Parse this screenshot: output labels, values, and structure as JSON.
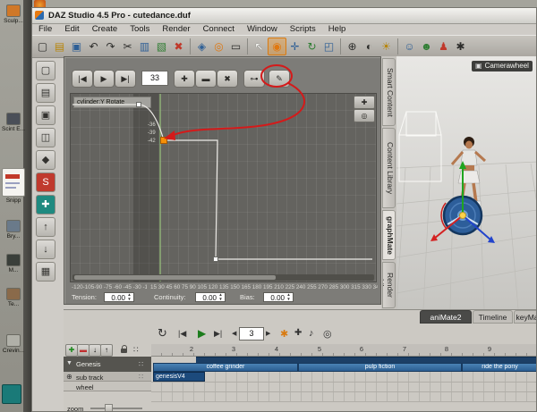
{
  "colors": {
    "accent_orange": "#f59008",
    "clip_blue": "#2b5e92",
    "annotation_red": "#d41a1a"
  },
  "desktop": {
    "items": [
      {
        "label": "Sculp..."
      },
      {
        "label": "Scint E..."
      },
      {
        "label": "Snipp"
      },
      {
        "label": "Bry..."
      },
      {
        "label": "M..."
      },
      {
        "label": "Te..."
      },
      {
        "label": "Crevin..."
      }
    ]
  },
  "titlebar": {
    "title": "DAZ Studio 4.5 Pro - cutedance.duf"
  },
  "menubar": {
    "items": [
      {
        "label": "File"
      },
      {
        "label": "Edit"
      },
      {
        "label": "Create"
      },
      {
        "label": "Tools"
      },
      {
        "label": "Render"
      },
      {
        "label": "Connect"
      },
      {
        "label": "Window"
      },
      {
        "label": "Scripts"
      },
      {
        "label": "Help"
      }
    ]
  },
  "toolbar": {
    "icons": [
      {
        "name": "new-icon",
        "glyph": "▢"
      },
      {
        "name": "open-icon",
        "glyph": "▤"
      },
      {
        "name": "save-icon",
        "glyph": "▣"
      },
      {
        "name": "undo-icon",
        "glyph": "↶"
      },
      {
        "name": "redo-icon",
        "glyph": "↷"
      },
      {
        "name": "cut-icon",
        "glyph": "✂"
      },
      {
        "name": "copy-icon",
        "glyph": "▥"
      },
      {
        "name": "paste-icon",
        "glyph": "▧"
      },
      {
        "name": "delete-icon",
        "glyph": "✖"
      },
      {
        "name": "scene-icon",
        "glyph": "◈"
      },
      {
        "name": "aim-icon",
        "glyph": "◎"
      },
      {
        "name": "frame-icon",
        "glyph": "▭"
      },
      {
        "name": "node-select-tool-icon",
        "glyph": "↖"
      },
      {
        "name": "active-pose-tool-icon",
        "glyph": "◉"
      },
      {
        "name": "translate-tool-icon",
        "glyph": "✛"
      },
      {
        "name": "rotate-tool-icon",
        "glyph": "↻"
      },
      {
        "name": "scale-tool-icon",
        "glyph": "◰"
      },
      {
        "name": "pan-tool-icon",
        "glyph": "⊕"
      },
      {
        "name": "camera-icon",
        "glyph": "◐"
      },
      {
        "name": "light-icon",
        "glyph": "☀"
      },
      {
        "name": "actor-icon",
        "glyph": "☺"
      },
      {
        "name": "actor2-icon",
        "glyph": "☻"
      },
      {
        "name": "pose-icon",
        "glyph": "♟"
      },
      {
        "name": "settings-icon",
        "glyph": "✱"
      }
    ]
  },
  "left_toolbar": {
    "icons": [
      {
        "name": "new-file-icon",
        "glyph": "▢"
      },
      {
        "name": "open-folder-icon",
        "glyph": "▤"
      },
      {
        "name": "save-file-icon",
        "glyph": "▣"
      },
      {
        "name": "merge-icon",
        "glyph": "◫"
      },
      {
        "name": "palette-icon",
        "glyph": "◆"
      },
      {
        "name": "snip-icon",
        "glyph": "S"
      },
      {
        "name": "teal-tool-icon",
        "glyph": "✚"
      },
      {
        "name": "move-up-icon",
        "glyph": "↑"
      },
      {
        "name": "move-down-icon",
        "glyph": "↓"
      },
      {
        "name": "cube-icon",
        "glyph": "▦"
      }
    ]
  },
  "graphmate": {
    "toolbar": {
      "goto_start": "|◀",
      "play": "▶",
      "goto_end": "▶|",
      "frame_value": "33",
      "add_key": "✚",
      "delete_key": "▬",
      "close": "✖",
      "key": "⊶",
      "draw": "✎"
    },
    "track_label": "cylinder:Y Rotate",
    "value_labels": [
      "-36",
      "-39",
      "-42"
    ],
    "x_axis_negative": "-120-105-90 -75 -60 -45 -30 -15",
    "x_axis_positive": "15 30 45 60 75 90 105 120 135 150 165 180 195 210 225 240 255 270 285 300 315 330 345 360",
    "mini": {
      "add": "✚",
      "zoom": "◎"
    },
    "tcb": {
      "tension_label": "Tension:",
      "tension_value": "0.00",
      "continuity_label": "Continuity:",
      "continuity_value": "0.00",
      "bias_label": "Bias:",
      "bias_value": "0.00"
    }
  },
  "side_tabs": {
    "items": [
      {
        "label": "Smart Content"
      },
      {
        "label": "Content Library"
      },
      {
        "label": "graphMate"
      },
      {
        "label": "Render Libr"
      }
    ]
  },
  "viewport": {
    "camera_label": "Camerawheel",
    "camera_icon": "▣"
  },
  "animate": {
    "tabs": [
      {
        "label": "aniMate2"
      },
      {
        "label": "Timeline"
      },
      {
        "label": "keyMa"
      }
    ],
    "transport": {
      "loop": "↻",
      "goto_start": "|◀",
      "play": "▶",
      "goto_end": "▶|",
      "prev": "◀",
      "next": "▶",
      "frame_value": "3",
      "tool": "✱",
      "add": "✚",
      "audio": "♪",
      "record": "◎"
    },
    "header_buttons": {
      "add": "✚",
      "remove": "▬",
      "move_down": "↓",
      "move_up": "↑",
      "grip": "∷"
    },
    "tracks": [
      {
        "arrow": "▼",
        "label": "Genesis"
      },
      {
        "plus": "⊕",
        "label": "sub track"
      },
      {
        "label": "wheel"
      }
    ],
    "ruler": [
      {
        "label": "2"
      },
      {
        "label": "3"
      },
      {
        "label": "4"
      },
      {
        "label": "5"
      },
      {
        "label": "6"
      },
      {
        "label": "7"
      },
      {
        "label": "8"
      },
      {
        "label": "9"
      }
    ],
    "clips": [
      {
        "label": "coffee grinder"
      },
      {
        "label": "pulp fiction"
      },
      {
        "label": "ride the pony"
      }
    ],
    "sub_clips": [
      {
        "label": "genesisV4"
      }
    ],
    "zoom_label": "zoom"
  }
}
